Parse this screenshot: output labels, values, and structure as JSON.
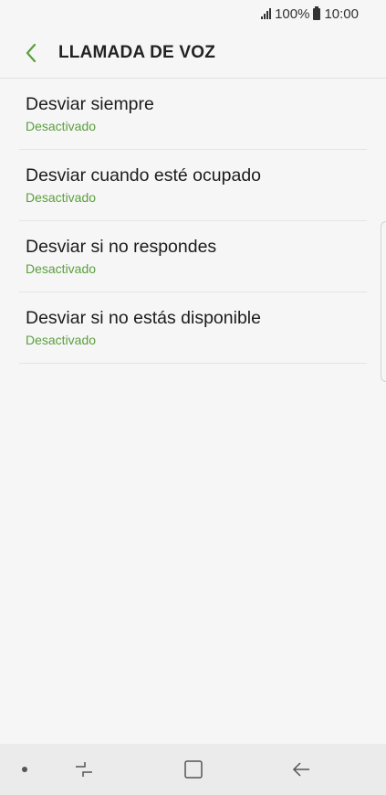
{
  "status_bar": {
    "battery_text": "100%",
    "time": "10:00"
  },
  "header": {
    "title": "LLAMADA DE VOZ",
    "accent_color": "#5a9f3d"
  },
  "items": [
    {
      "title": "Desviar siempre",
      "status": "Desactivado"
    },
    {
      "title": "Desviar cuando esté ocupado",
      "status": "Desactivado"
    },
    {
      "title": "Desviar si no respondes",
      "status": "Desactivado"
    },
    {
      "title": "Desviar si no estás disponible",
      "status": "Desactivado"
    }
  ],
  "nav_bar": {
    "icons": [
      "recent-apps-icon",
      "home-icon",
      "back-icon"
    ]
  }
}
